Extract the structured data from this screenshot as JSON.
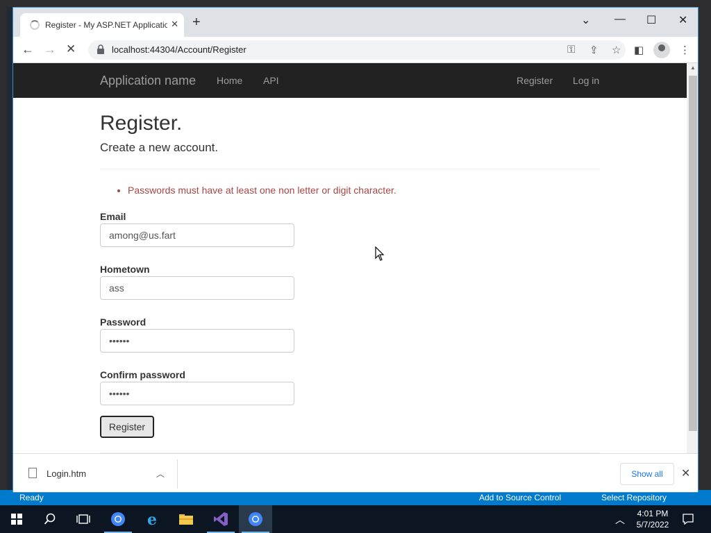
{
  "browser": {
    "tab_title": "Register - My ASP.NET Application",
    "url": "localhost:44304/Account/Register"
  },
  "navbar": {
    "brand": "Application name",
    "links": [
      "Home",
      "API"
    ],
    "right_links": [
      "Register",
      "Log in"
    ]
  },
  "page": {
    "title": "Register.",
    "subtitle": "Create a new account.",
    "errors": [
      "Passwords must have at least one non letter or digit character."
    ],
    "fields": [
      {
        "label": "Email",
        "value": "among@us.fart"
      },
      {
        "label": "Hometown",
        "value": "ass"
      },
      {
        "label": "Password",
        "value": "••••••"
      },
      {
        "label": "Confirm password",
        "value": "••••••"
      }
    ],
    "submit_label": "Register"
  },
  "downloads": {
    "file_name": "Login.htm",
    "show_all_label": "Show all"
  },
  "vs_status": {
    "ready": "Ready",
    "source_control": "Add to Source Control",
    "repository": "Select Repository"
  },
  "taskbar": {
    "time": "4:01 PM",
    "date": "5/7/2022"
  },
  "colors": {
    "navbar_bg": "#222222",
    "error_text": "#a94442",
    "accent": "#1a73e8"
  }
}
